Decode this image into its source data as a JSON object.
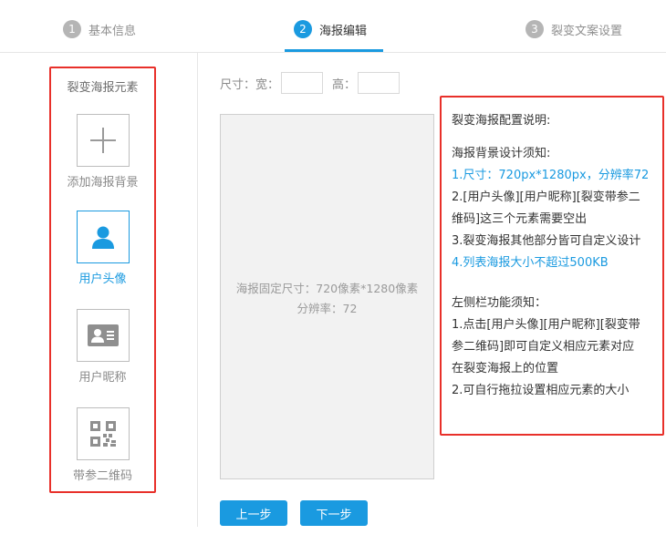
{
  "steps": [
    {
      "num": "1",
      "label": "基本信息",
      "active": false
    },
    {
      "num": "2",
      "label": "海报编辑",
      "active": true
    },
    {
      "num": "3",
      "label": "裂变文案设置",
      "active": false
    }
  ],
  "sidebar": {
    "title": "裂变海报元素",
    "tools": [
      {
        "label": "添加海报背景",
        "icon": "plus-icon"
      },
      {
        "label": "用户头像",
        "icon": "user-avatar-icon",
        "active": true
      },
      {
        "label": "用户昵称",
        "icon": "id-card-icon"
      },
      {
        "label": "带参二维码",
        "icon": "qr-code-icon"
      }
    ]
  },
  "size": {
    "prefix": "尺寸：宽：",
    "height_label": "高：",
    "width_value": "",
    "height_value": ""
  },
  "poster": {
    "line1": "海报固定尺寸：720像素*1280像素",
    "line2": "分辨率：72"
  },
  "buttons": {
    "prev": "上一步",
    "next": "下一步"
  },
  "info": {
    "title": "裂变海报配置说明:",
    "bg_heading": "海报背景设计须知:",
    "bg_items": [
      "1.尺寸：720px*1280px，分辨率72",
      "2.[用户头像][用户昵称][裂变带参二",
      "维码]这三个元素需要空出",
      "3.裂变海报其他部分皆可自定义设计",
      "4.列表海报大小不超过500KB"
    ],
    "side_heading": "左侧栏功能须知：",
    "side_items": [
      "1.点击[用户头像][用户昵称][裂变带",
      "参二维码]即可自定义相应元素对应",
      "在裂变海报上的位置",
      "2.可自行拖拉设置相应元素的大小"
    ]
  },
  "colors": {
    "accent": "#1a9ae0",
    "highlight_border": "#e8302a"
  }
}
